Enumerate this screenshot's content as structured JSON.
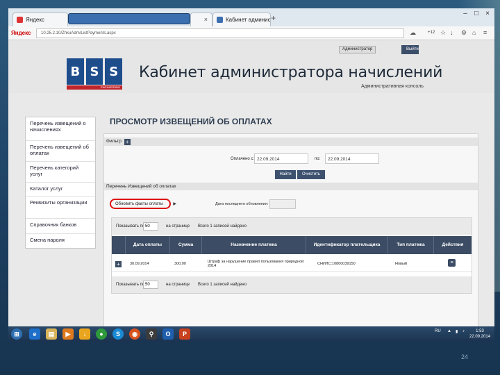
{
  "browser": {
    "tab1_title": "Яндекс",
    "tab2_title": "Кабинет администратора",
    "url": "10.25.2.10/ZhkuAdm/ListPayments.aspx",
    "search_brand": "Яндекс",
    "zoom": "+12"
  },
  "header": {
    "logo_text": "BSS",
    "logo_tagline": "ENGINEERING",
    "title": "Кабинет администратора начислений",
    "subtitle": "Административная консоль",
    "user": "Администратор",
    "logout": "Выйти"
  },
  "sidebar": {
    "items": [
      {
        "label": "Перечень извещений о начислениях"
      },
      {
        "label": "Перечень извещений об оплатах"
      },
      {
        "label": "Перечень категорий услуг"
      },
      {
        "label": "Каталог услуг"
      },
      {
        "label": "Реквизиты организации"
      },
      {
        "label": "Справочник банков"
      },
      {
        "label": "Смена пароля"
      }
    ]
  },
  "main": {
    "title": "ПРОСМОТР ИЗВЕЩЕНИЙ ОБ ОПЛАТАХ",
    "filter_label": "Фильтр",
    "period_from_label": "Оплачено с:",
    "period_from": "22.09.2014",
    "period_to_label": "по:",
    "period_to": "22.09.2014",
    "find_button": "Найти",
    "clear_button": "Очистить",
    "list_title": "Перечень Извещений об оплатах",
    "refresh_button": "Обновить факты оплаты",
    "last_update_label": "Дата последнего обновления:",
    "last_update_value": ""
  },
  "grid": {
    "show_label": "Показывать по",
    "page_size": "50",
    "per_page_label": "на странице",
    "total_label": "Всего 1 записей найдено",
    "columns": [
      "",
      "Дата оплаты",
      "Сумма",
      "Назначение платежа",
      "Идентификатор плательщика",
      "Тип платежа",
      "Действия"
    ],
    "rows": [
      {
        "date": "30.09.2014",
        "amount": "300,00",
        "purpose": "Штраф за нарушение правил пользования природной 2014",
        "payer_id": "СНИЛС:10800039150",
        "type": "Новый"
      }
    ]
  },
  "taskbar": {
    "lang": "RU",
    "time": "1:53",
    "date": "22.09.2014"
  },
  "slide_number": "24"
}
